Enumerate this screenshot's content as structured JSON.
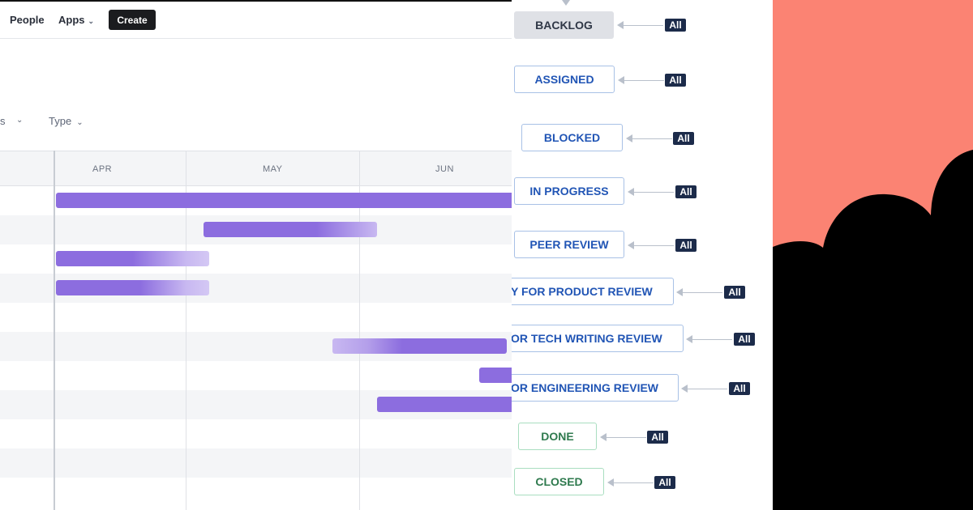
{
  "app": {
    "nav": {
      "people": "People",
      "apps": "Apps",
      "create": "Create"
    },
    "filters": {
      "status_fragment": "s",
      "type": "Type"
    },
    "months": [
      "APR",
      "MAY",
      "JUN"
    ]
  },
  "workflow": {
    "statuses": [
      {
        "label": "BACKLOG",
        "style": "grey",
        "badge": "All"
      },
      {
        "label": "ASSIGNED",
        "style": "blue",
        "badge": "All"
      },
      {
        "label": "BLOCKED",
        "style": "blue",
        "badge": "All"
      },
      {
        "label": "IN PROGRESS",
        "style": "blue",
        "badge": "All"
      },
      {
        "label": "PEER REVIEW",
        "style": "blue",
        "badge": "All"
      },
      {
        "label": "Y FOR PRODUCT REVIEW",
        "style": "blue",
        "badge": "All"
      },
      {
        "label": "OR TECH WRITING REVIEW",
        "style": "blue",
        "badge": "All"
      },
      {
        "label": "OR ENGINEERING REVIEW",
        "style": "blue",
        "badge": "All"
      },
      {
        "label": "DONE",
        "style": "green",
        "badge": "All"
      },
      {
        "label": "CLOSED",
        "style": "green",
        "badge": "All"
      }
    ]
  },
  "colors": {
    "bar": "#8c6ddf",
    "create_button": "#1b1c1f",
    "badge": "#1c2b4a",
    "status_blue_text": "#2155b5",
    "status_green_text": "#2f7a4e",
    "deco_background": "#fb8373",
    "deco_shape": "#000000"
  },
  "icons": {
    "dropdown": "chevron-down-icon",
    "transition": "arrow-left-icon"
  }
}
